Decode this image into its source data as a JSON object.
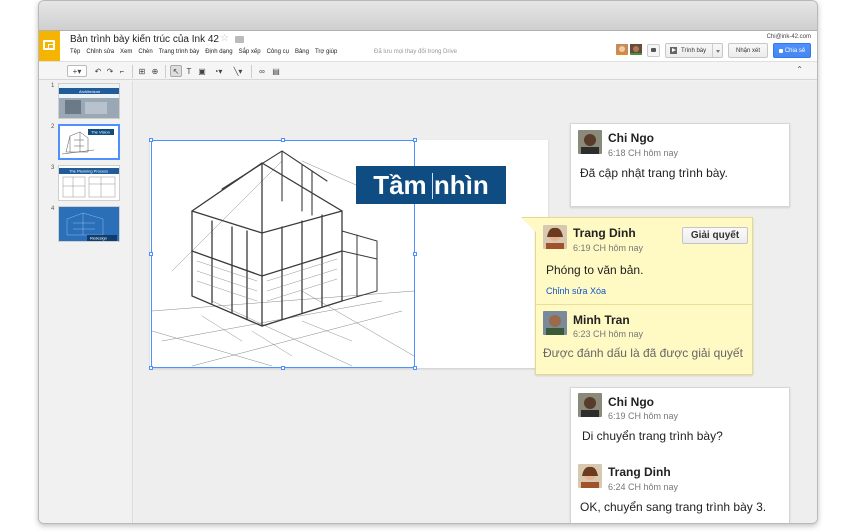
{
  "header": {
    "doc_title": "Bản trình bày kiến trúc của Ink 42",
    "user_email": "Chi@ink-42.com",
    "save_status": "Đã lưu mọi thay đổi trong Drive",
    "present_label": "Trình bày",
    "comments_label": "Nhận xét",
    "share_label": "Chia sẻ"
  },
  "menu": [
    "Tệp",
    "Chỉnh sửa",
    "Xem",
    "Chèn",
    "Trang trình bày",
    "Định dạng",
    "Sắp xếp",
    "Công cụ",
    "Bảng",
    "Trợ giúp"
  ],
  "filmstrip": {
    "slides": [
      {
        "num": "1",
        "label": "Architecture"
      },
      {
        "num": "2",
        "label": "The Vision"
      },
      {
        "num": "3",
        "label": "The Planning Process"
      },
      {
        "num": "4",
        "label": "Redesign"
      }
    ]
  },
  "slide": {
    "title": "Tầm nhìn"
  },
  "comments": {
    "c1": {
      "author": "Chi Ngo",
      "time": "6:18 CH hôm nay",
      "text": "Đã cập nhật trang trình bày."
    },
    "c2": {
      "author": "Trang Dinh",
      "time": "6:19 CH hôm nay",
      "text": "Phóng to văn bản.",
      "actions": "Chỉnh sửa Xóa",
      "resolve_label": "Giải quyết",
      "reply": {
        "author": "Minh Tran",
        "time": "6:23 CH hôm nay",
        "text": "Được đánh dấu là đã được giải quyết"
      }
    },
    "c3": {
      "author": "Chi Ngo",
      "time": "6:19 CH hôm nay",
      "text": "Di chuyển trang trình bày?",
      "reply": {
        "author": "Trang Dinh",
        "time": "6:24 CH hôm nay",
        "text": "OK, chuyển sang trang trình bày 3."
      }
    }
  },
  "colors": {
    "accent": "#4d90fe",
    "logo": "#f4b400",
    "title_bg": "#0f4c81",
    "active_comment": "#fff9c4"
  }
}
